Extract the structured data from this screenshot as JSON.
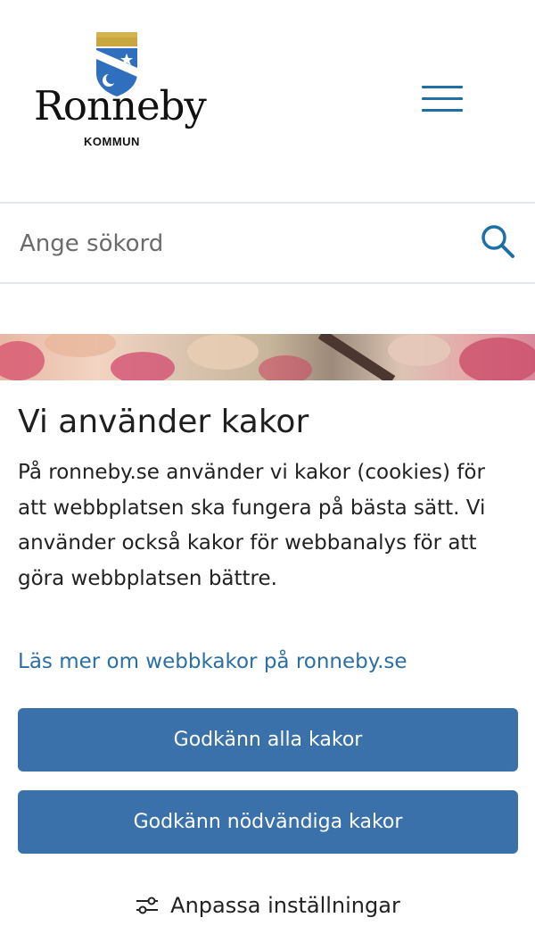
{
  "header": {
    "logo_word": "Ronneby",
    "logo_sub": "KOMMUN",
    "menu_icon": "hamburger-menu-icon"
  },
  "search": {
    "placeholder": "Ange sökord",
    "icon": "search-icon"
  },
  "cookie_banner": {
    "title": "Vi använder kakor",
    "body": "På ronneby.se använder vi kakor (cookies) för att webbplatsen ska fungera på bästa sätt. Vi använder också kakor för webbanalys för att göra webbplatsen bättre.",
    "link": "Läs mer om webbkakor på ronneby.se",
    "accept_all": "Godkänn alla kakor",
    "accept_necessary": "Godkänn nödvändiga kakor",
    "customize": "Anpassa inställningar",
    "customize_icon": "sliders-icon"
  },
  "colors": {
    "accent": "#1e6fa6",
    "button": "#3a71ab",
    "link": "#2c6fa5"
  }
}
